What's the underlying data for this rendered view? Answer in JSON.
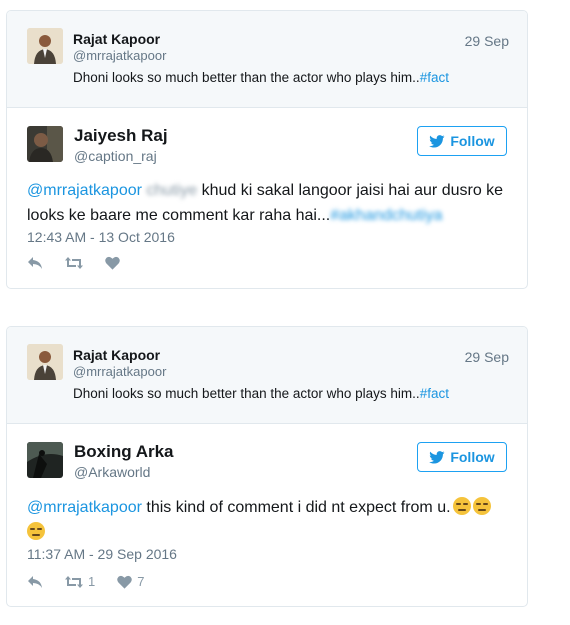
{
  "tweets": [
    {
      "quoted": {
        "name": "Rajat Kapoor",
        "handle": "@mrrajatkapoor",
        "date": "29 Sep",
        "text": "Dhoni looks so much better than the actor who plays him..",
        "hashtag": "#fact"
      },
      "author": {
        "name": "Jaiyesh Raj",
        "handle": "@caption_raj"
      },
      "follow_label": "Follow",
      "text": {
        "mention": "@mrrajatkapoor",
        "blurred_word": "chutiye",
        "line1_rest": "khud ki sakal langoor jaisi hai aur dusro ke",
        "line2": "looks ke baare me comment kar raha hai...",
        "blurred_tag": "#akhandchutiya"
      },
      "timestamp": "12:43 AM - 13 Oct 2016",
      "retweet_count": "",
      "like_count": ""
    },
    {
      "quoted": {
        "name": "Rajat Kapoor",
        "handle": "@mrrajatkapoor",
        "date": "29 Sep",
        "text": "Dhoni looks so much better than the actor who plays him..",
        "hashtag": "#fact"
      },
      "author": {
        "name": "Boxing Arka",
        "handle": "@Arkaworld"
      },
      "follow_label": "Follow",
      "text": {
        "mention": "@mrrajatkapoor",
        "body": "this kind of comment i did nt expect from u."
      },
      "timestamp": "11:37 AM - 29 Sep 2016",
      "retweet_count": "1",
      "like_count": "7"
    }
  ],
  "colors": {
    "accent": "#1b95e0",
    "muted": "#657786",
    "border": "#e1e8ed",
    "quoted_bg": "#f5f8fa"
  },
  "icons": [
    "reply-icon",
    "retweet-icon",
    "like-icon",
    "twitter-bird-icon",
    "expressionless-face-emoji"
  ]
}
